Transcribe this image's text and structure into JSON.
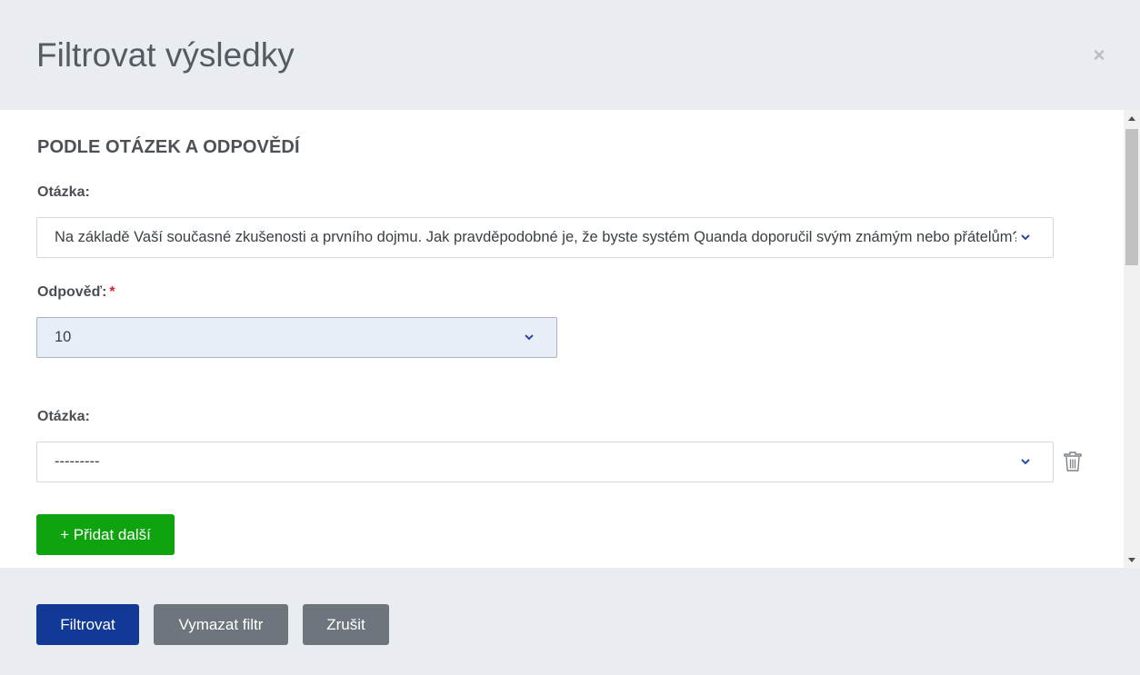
{
  "modal": {
    "title": "Filtrovat výsledky",
    "close_symbol": "×"
  },
  "section": {
    "title": "PODLE OTÁZEK A ODPOVĚDÍ"
  },
  "filter_1": {
    "question_label": "Otázka:",
    "question_value": "Na základě Vaší současné zkušenosti a prvního dojmu. Jak pravděpodobné je, že byste systém Quanda doporučil svým známým nebo přátelům?",
    "answer_label": "Odpověď:",
    "answer_required_mark": "*",
    "answer_value": "10"
  },
  "filter_2": {
    "question_label": "Otázka:",
    "question_value": "---------"
  },
  "add_button_label": "+ Přidat další",
  "footer": {
    "filter_label": "Filtrovat",
    "clear_label": "Vymazat filtr",
    "cancel_label": "Zrušit"
  },
  "icons": {
    "dropdown": "chevron-down-icon",
    "delete": "trash-icon",
    "close": "close-icon"
  },
  "colors": {
    "primary": "#123996",
    "success": "#0fa40f",
    "secondary": "#6e757c",
    "required": "#d9232d",
    "chevron": "#2a4aa0"
  }
}
